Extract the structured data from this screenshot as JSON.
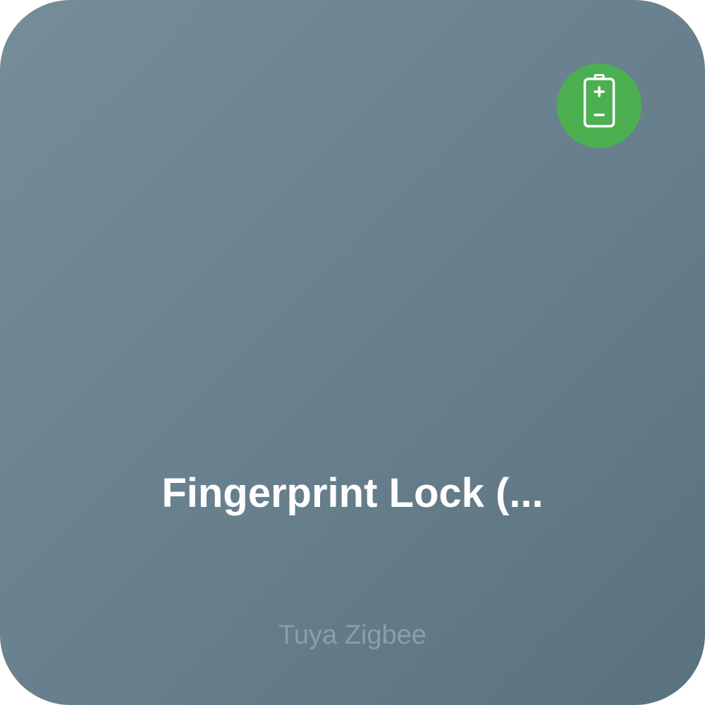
{
  "device": {
    "name": "Fingerprint Lock (...",
    "platform": "Tuya Zigbee"
  },
  "badge": {
    "icon": "battery-icon",
    "color": "#4caf50"
  },
  "colors": {
    "card_gradient_start": "#758d99",
    "card_gradient_end": "#5a717e",
    "name_text": "#ffffff",
    "platform_text": "#8b9ea9"
  }
}
